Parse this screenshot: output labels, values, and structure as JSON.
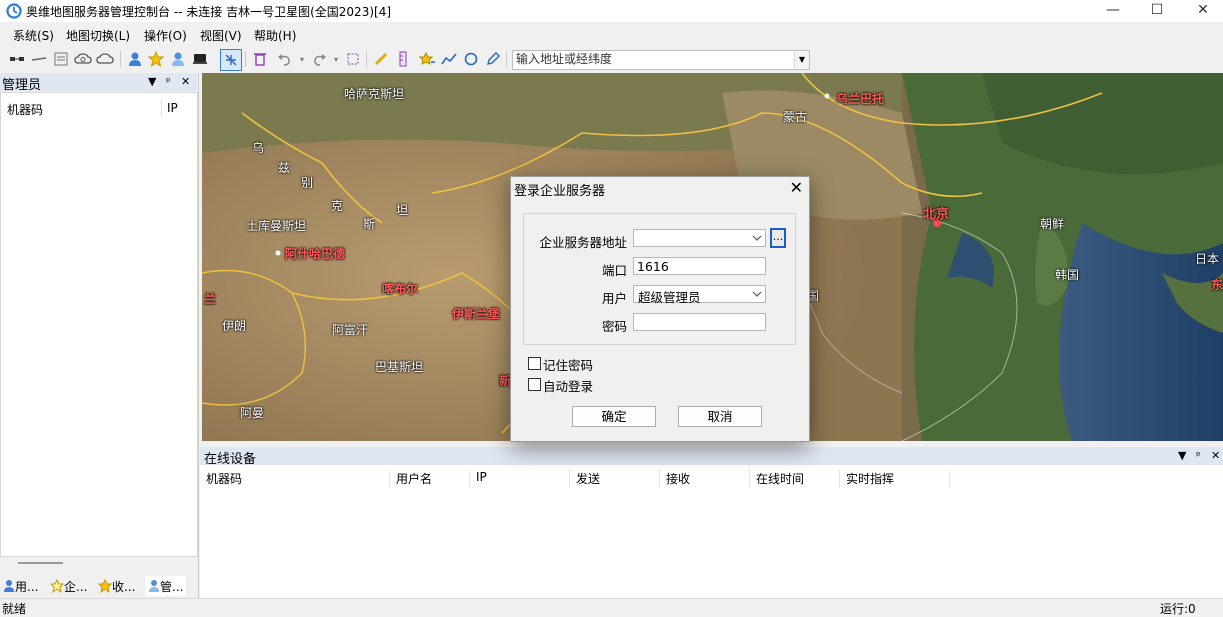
{
  "window": {
    "title": "奥维地图服务器管理控制台 -- 未连接 吉林一号卫星图(全国2023)[4]",
    "minimize": "—",
    "maximize": "☐",
    "close": "✕"
  },
  "menu": {
    "items": [
      "系统(S)",
      "地图切换(L)",
      "操作(O)",
      "视图(V)",
      "帮助(H)"
    ]
  },
  "toolbar": {
    "address_placeholder": "输入地址或经纬度",
    "address_value": ""
  },
  "left_panel": {
    "title": "管理员",
    "columns": [
      "机器码",
      "IP"
    ],
    "tabs": [
      "用...",
      "企...",
      "收...",
      "管..."
    ],
    "tab_icons": [
      "user-icon",
      "star-user-icon",
      "star-icon",
      "admin-icon"
    ]
  },
  "map": {
    "labels": [
      {
        "text": "哈萨克斯坦",
        "style": "white"
      },
      {
        "text": "蒙古",
        "style": "white"
      },
      {
        "text": "乌兰巴托",
        "style": "red"
      },
      {
        "text": "乌",
        "style": "white"
      },
      {
        "text": "兹",
        "style": "white"
      },
      {
        "text": "别",
        "style": "white"
      },
      {
        "text": "克",
        "style": "white"
      },
      {
        "text": "斯",
        "style": "white"
      },
      {
        "text": "坦",
        "style": "white"
      },
      {
        "text": "土库曼斯坦",
        "style": "white"
      },
      {
        "text": "阿什哈巴德",
        "style": "red"
      },
      {
        "text": "喀布尔",
        "style": "red"
      },
      {
        "text": "伊斯兰堡",
        "style": "red"
      },
      {
        "text": "伊朗",
        "style": "white"
      },
      {
        "text": "阿富汗",
        "style": "white"
      },
      {
        "text": "巴基斯坦",
        "style": "white"
      },
      {
        "text": "阿曼",
        "style": "white"
      },
      {
        "text": "北京",
        "style": "red"
      },
      {
        "text": "朝鲜",
        "style": "white"
      },
      {
        "text": "韩国",
        "style": "white"
      },
      {
        "text": "日本",
        "style": "white"
      },
      {
        "text": "国",
        "style": "white"
      },
      {
        "text": "兰",
        "style": "red"
      },
      {
        "text": "新",
        "style": "red"
      },
      {
        "text": "东",
        "style": "red"
      }
    ]
  },
  "bottom_panel": {
    "title": "在线设备",
    "columns": [
      "机器码",
      "用户名",
      "IP",
      "发送",
      "接收",
      "在线时间",
      "实时指挥"
    ]
  },
  "pane_buttons": {
    "dropdown": "▼",
    "pin": "ᵖ",
    "close": "✕"
  },
  "status": {
    "left": "就绪",
    "right": "运行:0"
  },
  "dialog": {
    "title": "登录企业服务器",
    "close": "✕",
    "server_label": "企业服务器地址",
    "server_value": "",
    "browse_label": "...",
    "port_label": "端口",
    "port_value": "1616",
    "user_label": "用户",
    "user_value": "超级管理员",
    "password_label": "密码",
    "password_value": "",
    "remember_label": "记住密码",
    "remember_checked": false,
    "autologin_label": "自动登录",
    "autologin_checked": false,
    "ok_label": "确定",
    "cancel_label": "取消"
  }
}
